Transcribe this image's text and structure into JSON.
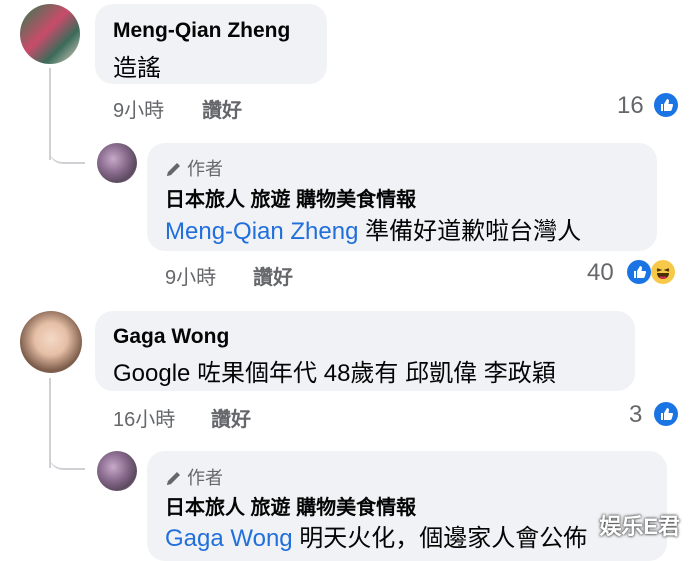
{
  "comments": [
    {
      "author": "Meng-Qian Zheng",
      "text": "造謠",
      "time": "9小時",
      "like_label": "讚好",
      "reaction_count": "16",
      "reply": {
        "badge": "作者",
        "page_name": "日本旅人  旅遊 購物美食情報",
        "mention": "Meng-Qian Zheng",
        "text": " 準備好道歉啦台灣人",
        "time": "9小時",
        "like_label": "讚好",
        "reaction_count": "40"
      }
    },
    {
      "author": "Gaga Wong",
      "text": "Google 咗果個年代 48歲有 邱凱偉 李政穎",
      "time": "16小時",
      "like_label": "讚好",
      "reaction_count": "3",
      "reply": {
        "badge": "作者",
        "page_name": "日本旅人  旅遊 購物美食情報",
        "mention": "Gaga Wong",
        "text": " 明天火化，個邊家人會公佈"
      }
    }
  ],
  "watermark": "娱乐E君",
  "icons": [
    "pencil-icon",
    "like-reaction-icon",
    "haha-reaction-icon"
  ]
}
